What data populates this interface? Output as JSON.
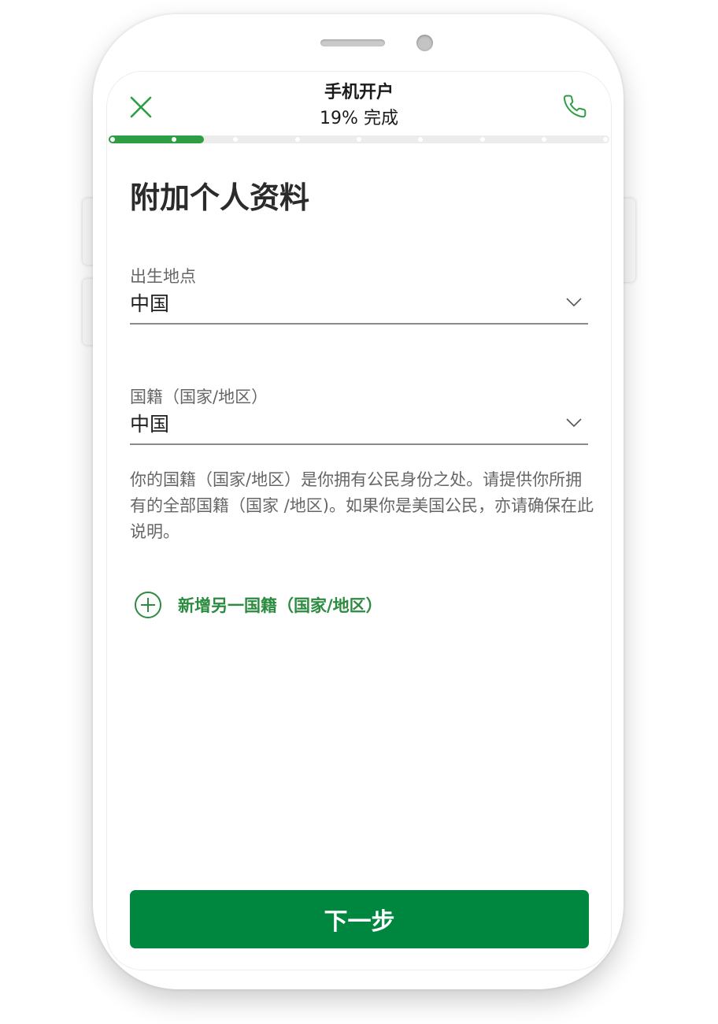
{
  "header": {
    "title": "手机开户",
    "progress_text": "19% 完成",
    "close_icon": "close-icon",
    "phone_icon": "phone-icon"
  },
  "progress": {
    "percent": 19,
    "steps": 9,
    "completed_steps": 2
  },
  "page": {
    "title": "附加个人资料"
  },
  "fields": {
    "birthplace": {
      "label": "出生地点",
      "value": "中国"
    },
    "nationality": {
      "label": "国籍（国家/地区）",
      "value": "中国"
    }
  },
  "help_text": "你的国籍（国家/地区）是你拥有公民身份之处。请提供你所拥有的全部国籍（国家 /地区)。如果你是美国公民，亦请确保在此说明。",
  "add_nationality": {
    "label": "新增另一国籍（国家/地区）",
    "icon": "plus-circle-icon"
  },
  "next_button": {
    "label": "下一步"
  },
  "colors": {
    "brand_green": "#00873f",
    "accent_green": "#2e9e45",
    "link_green": "#2b8b3f"
  }
}
